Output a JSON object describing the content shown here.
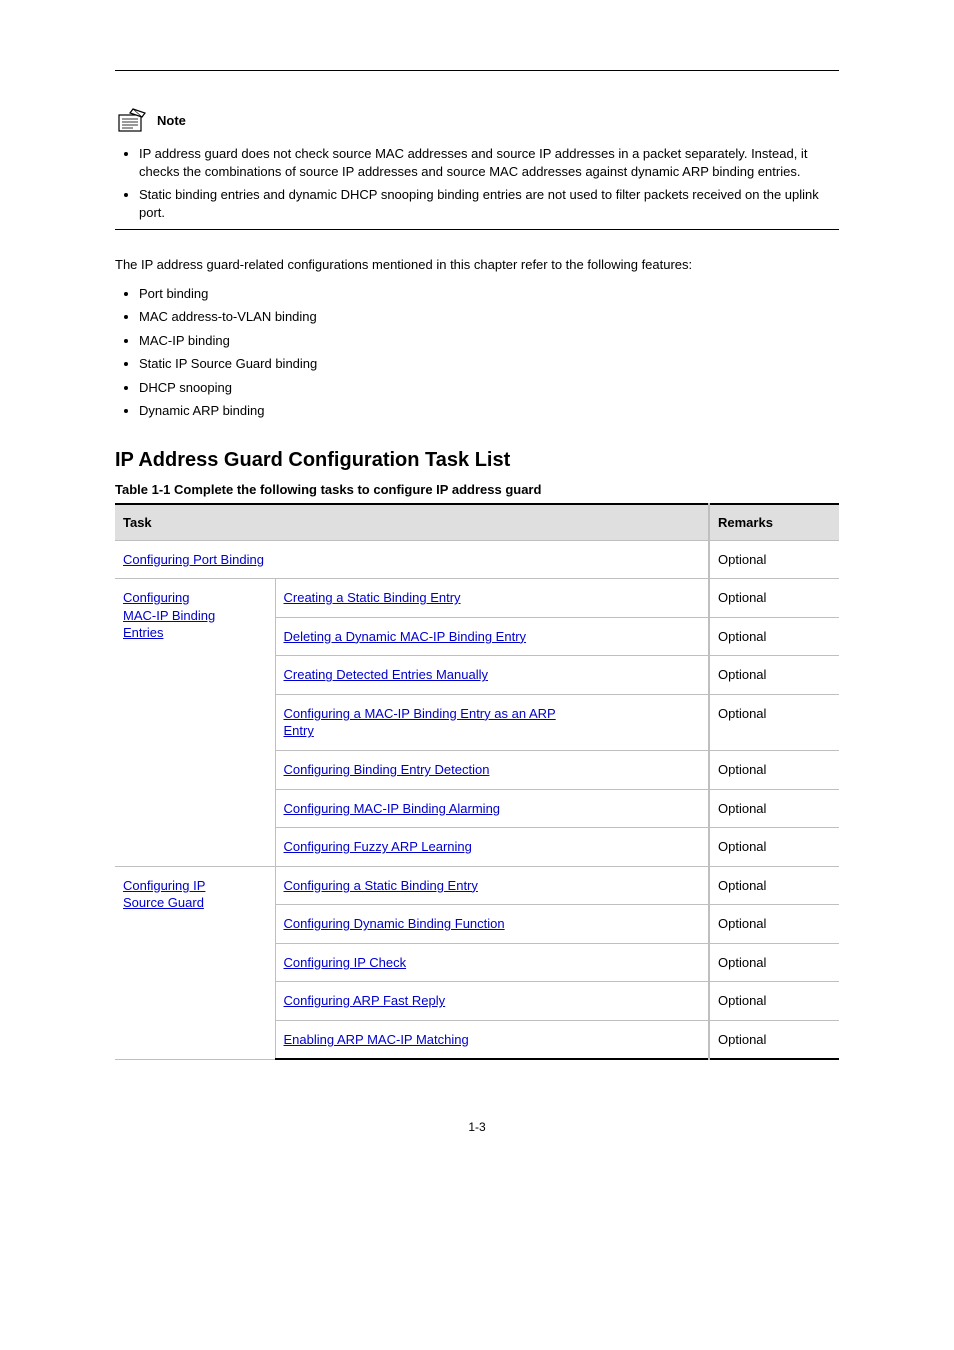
{
  "note": {
    "label": "Note",
    "items": [
      "IP address guard does not check source MAC addresses and source IP addresses in a packet separately. Instead, it checks the combinations of source IP addresses and source MAC addresses against dynamic ARP binding entries.",
      "Static binding entries and dynamic DHCP snooping binding entries are not used to filter packets received on the uplink port."
    ]
  },
  "intro_para": "The IP address guard-related configurations mentioned in this chapter refer to the following features:",
  "features": [
    "Port binding",
    "MAC address-to-VLAN binding",
    "MAC-IP binding",
    "Static IP Source Guard binding",
    "DHCP snooping",
    "Dynamic ARP binding"
  ],
  "taskList": {
    "heading": "IP Address Guard Configuration Task List",
    "tableCaption": "Table 1-1 Complete the following tasks to configure IP address guard",
    "headers": {
      "task": "Task",
      "remarks": "Remarks"
    },
    "rows": {
      "r0": {
        "task_link": "Configuring Port Binding",
        "remarks": "Optional"
      },
      "group1_left_line1": "Configuring",
      "group1_left_line2": "MAC-IP Binding",
      "group1_left_link": "Entries",
      "r1": {
        "link": "Creating a Static Binding Entry",
        "remarks": "Optional"
      },
      "r2": {
        "link": "Deleting a Dynamic MAC-IP Binding Entry",
        "remarks": "Optional"
      },
      "r3": {
        "link": "Creating Detected Entries Manually",
        "remarks": "Optional"
      },
      "r4": {
        "link_pre": "Configuring a MAC-IP Binding Entry as an ARP",
        "link_suf": "Entry",
        "remarks": "Optional"
      },
      "r5": {
        "link": "Configuring Binding Entry Detection",
        "remarks": "Optional"
      },
      "r6": {
        "link": "Configuring MAC-IP Binding Alarming",
        "remarks": "Optional"
      },
      "r7": {
        "link": "Configuring Fuzzy ARP Learning",
        "remarks": "Optional"
      },
      "group2_left_line1": "Configuring IP",
      "group2_left_link": "Source Guard",
      "r8": {
        "link": "Configuring a Static Binding Entry",
        "remarks": "Optional"
      },
      "r9": {
        "link": "Configuring Dynamic Binding Function",
        "remarks": "Optional"
      },
      "r10": {
        "link": "Configuring IP Check",
        "remarks": "Optional"
      },
      "r11": {
        "link": "Configuring ARP Fast Reply",
        "remarks": "Optional"
      },
      "r12": {
        "link": "Enabling ARP MAC-IP Matching",
        "remarks": "Optional"
      }
    }
  },
  "pageNumber": "1-3"
}
